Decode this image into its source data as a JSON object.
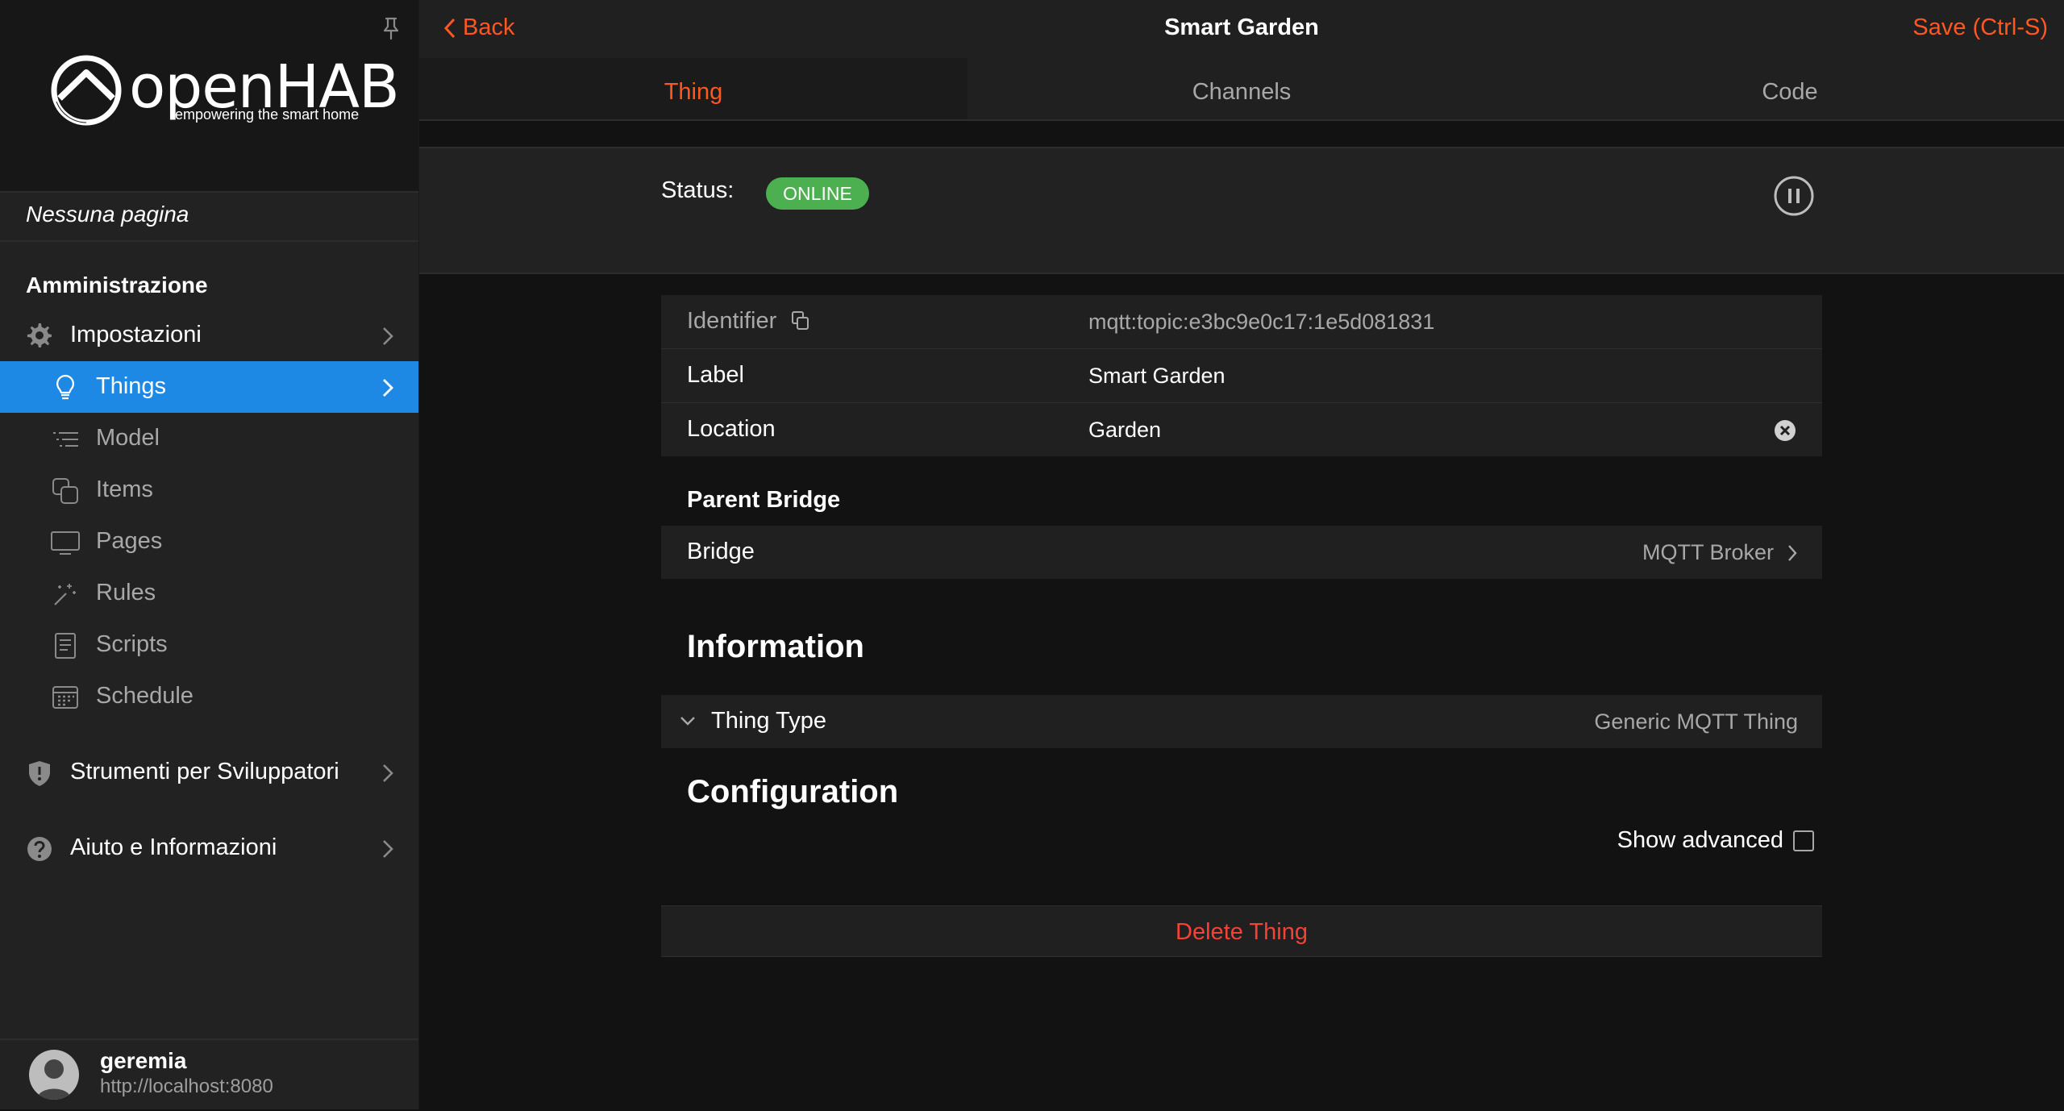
{
  "sidebar": {
    "logo": {
      "word": "openHAB",
      "tagline": "empowering the smart home"
    },
    "no_page": "Nessuna pagina",
    "section_title": "Amministrazione",
    "items": [
      {
        "label": "Impostazioni",
        "icon": "gear-icon"
      },
      {
        "label": "Things",
        "icon": "lightbulb-icon",
        "active": true
      },
      {
        "label": "Model",
        "icon": "list-icon"
      },
      {
        "label": "Items",
        "icon": "copy-icon"
      },
      {
        "label": "Pages",
        "icon": "monitor-icon"
      },
      {
        "label": "Rules",
        "icon": "magic-wand-icon"
      },
      {
        "label": "Scripts",
        "icon": "document-icon"
      },
      {
        "label": "Schedule",
        "icon": "calendar-icon"
      },
      {
        "label": "Strumenti per Sviluppatori",
        "icon": "shield-icon"
      },
      {
        "label": "Aiuto e Informazioni",
        "icon": "help-icon"
      }
    ],
    "user": {
      "name": "geremia",
      "url": "http://localhost:8080"
    }
  },
  "navbar": {
    "back_label": "Back",
    "title": "Smart Garden",
    "save_label": "Save (Ctrl-S)"
  },
  "tabs": [
    {
      "label": "Thing",
      "active": true
    },
    {
      "label": "Channels"
    },
    {
      "label": "Code"
    }
  ],
  "status": {
    "label": "Status:",
    "value": "ONLINE"
  },
  "properties": [
    {
      "key": "Identifier",
      "value": "mqtt:topic:e3bc9e0c17:1e5d081831"
    },
    {
      "key": "Label",
      "value": "Smart Garden"
    },
    {
      "key": "Location",
      "value": "Garden"
    }
  ],
  "parent_bridge": {
    "title": "Parent Bridge",
    "key": "Bridge",
    "value": "MQTT Broker"
  },
  "information": {
    "title": "Information",
    "thing_type_key": "Thing Type",
    "thing_type_value": "Generic MQTT Thing"
  },
  "configuration": {
    "title": "Configuration",
    "show_advanced": "Show advanced"
  },
  "delete_label": "Delete Thing",
  "colors": {
    "accent": "#ff5722",
    "active_nav": "#1e88e5",
    "online": "#4caf50",
    "danger": "#f44336"
  }
}
